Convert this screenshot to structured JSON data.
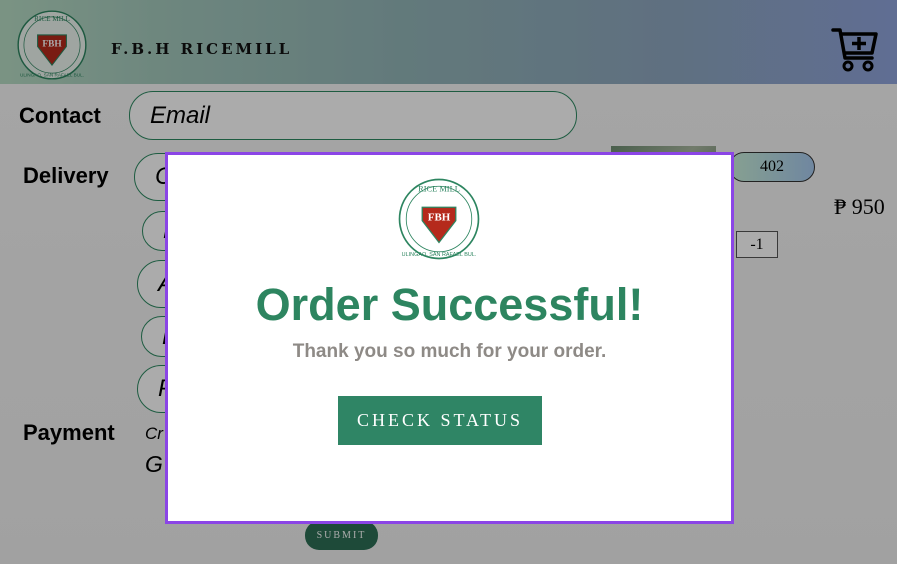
{
  "header": {
    "brand": "F.B.H RICEMILL",
    "logo_top_text": "RICE     MILL",
    "logo_mark": "FBH",
    "logo_bottom_text": "ULINGAO, SAN RAFAEL BUL.",
    "cart_icon": "cart-plus-icon"
  },
  "form": {
    "contact_label": "Contact",
    "email_placeholder": "Email",
    "delivery_label": "Delivery",
    "delivery_field_1": "Co",
    "delivery_field_2": "F",
    "delivery_field_3": "A",
    "delivery_field_4": "P",
    "delivery_field_5": "P",
    "payment_label": "Payment",
    "payment_option_1": "Cr",
    "payment_option_2": "G",
    "submit_label": "SUBMIT"
  },
  "cart_item": {
    "quantity": "402",
    "price": "₱ 950",
    "decrement": "-1"
  },
  "modal": {
    "title": "Order Successful!",
    "subtitle": "Thank you so much for your order.",
    "button_label": "CHECK STATUS"
  },
  "colors": {
    "brand_green": "#2d8560",
    "modal_border": "#8b45e6",
    "logo_red": "#b52a1c"
  }
}
